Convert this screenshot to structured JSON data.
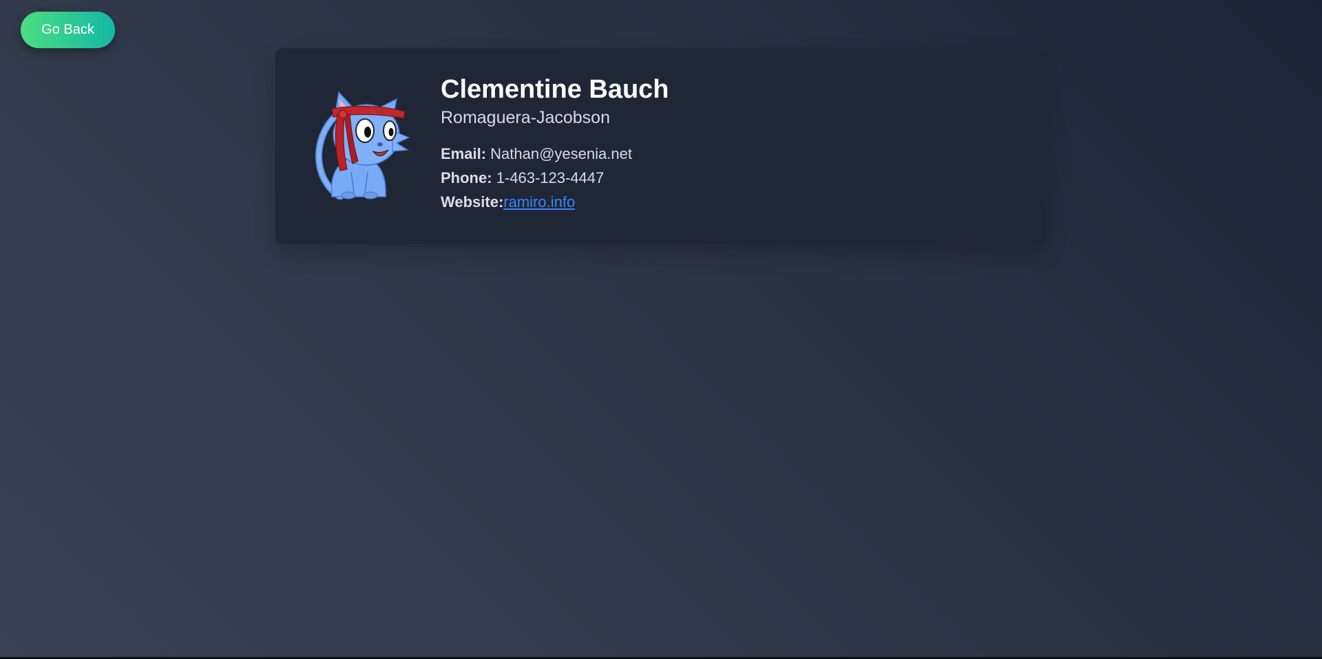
{
  "nav": {
    "back_label": "Go Back"
  },
  "profile": {
    "name": "Clementine Bauch",
    "company": "Romaguera-Jacobson",
    "email_label": "Email:",
    "email": "Nathan@yesenia.net",
    "phone_label": "Phone:",
    "phone": "1-463-123-4447",
    "website_label": "Website:",
    "website": "ramiro.info",
    "avatar_icon": "blue-cat-headband-avatar-icon"
  },
  "colors": {
    "button_gradient_start": "#4ade80",
    "button_gradient_end": "#14b8a6",
    "card_background": "#1f2737",
    "link": "#3b82f6"
  }
}
